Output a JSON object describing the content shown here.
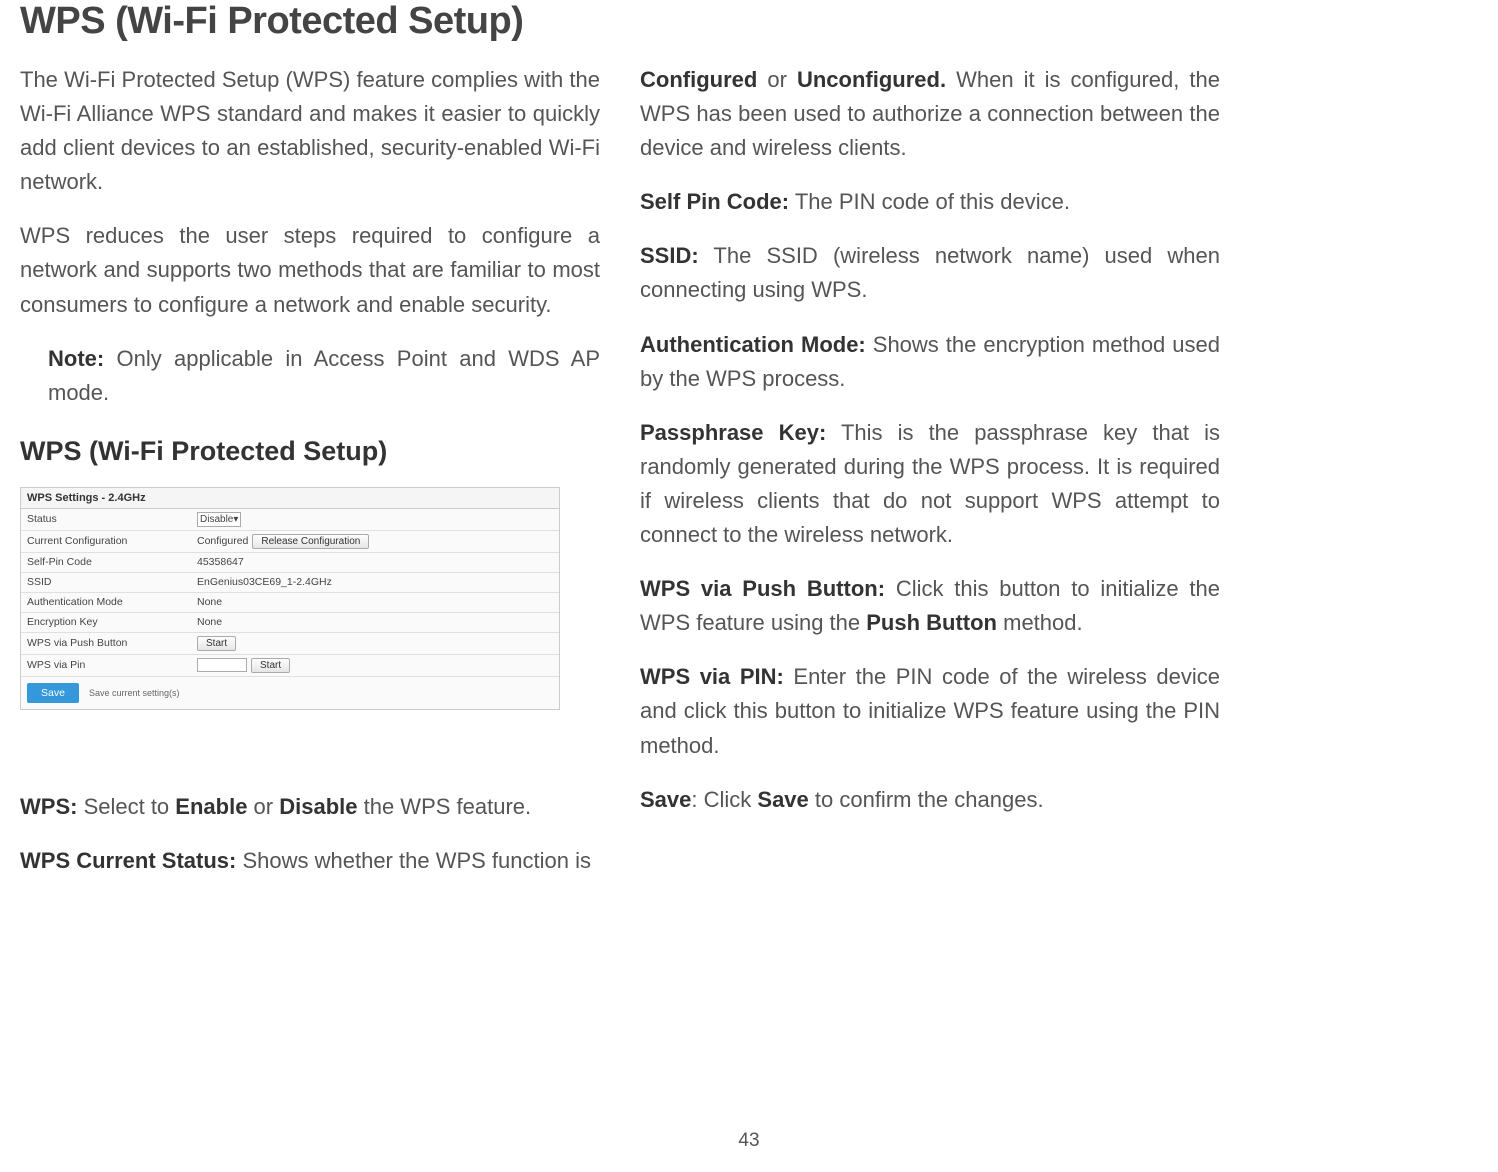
{
  "page_title": "WPS (Wi-Fi Protected Setup)",
  "left": {
    "para1": "The Wi-Fi Protected Setup (WPS) feature complies with the Wi-Fi Alliance WPS standard and makes it easier to quickly add client devices to an established, security-enabled Wi-Fi network.",
    "para2": "WPS reduces the user steps required to configure a network and supports two methods that are familiar to most consumers to configure a network and enable security.",
    "note_label": "Note:",
    "note_text": " Only applicable in Access Point and WDS AP mode.",
    "section_header": "WPS (Wi-Fi Protected Setup)",
    "panel": {
      "title": "WPS Settings - 2.4GHz",
      "rows": {
        "status_label": "Status",
        "status_value": "Disable",
        "cc_label": "Current Configuration",
        "cc_value": "Configured",
        "cc_button": "Release Configuration",
        "pin_label": "Self-Pin Code",
        "pin_value": "45358647",
        "ssid_label": "SSID",
        "ssid_value": "EnGenius03CE69_1-2.4GHz",
        "auth_label": "Authentication Mode",
        "auth_value": "None",
        "enc_label": "Encryption Key",
        "enc_value": "None",
        "push_label": "WPS via Push Button",
        "push_button": "Start",
        "pin_via_label": "WPS via Pin",
        "pin_via_button": "Start"
      },
      "save_label": "Save",
      "save_hint": "Save current setting(s)"
    },
    "wps_label": "WPS:",
    "wps_text": " Select to ",
    "wps_enable": "Enable",
    "wps_or": " or ",
    "wps_disable": "Disable",
    "wps_text2": " the WPS feature.",
    "status_label": "WPS Current Status:",
    "status_text": " Shows whether the WPS function is"
  },
  "right": {
    "p1_b1": "Configured",
    "p1_mid": " or ",
    "p1_b2": "Unconfigured.",
    "p1_rest": " When it is configured, the WPS has been used to authorize a connection between the device and wireless clients.",
    "p2_b": "Self Pin Code:",
    "p2_rest": " The PIN code of this device.",
    "p3_b": "SSID:",
    "p3_rest": " The SSID (wireless network name) used when connecting using WPS.",
    "p4_b": "Authentication Mode:",
    "p4_rest": " Shows the encryption method used by the WPS process.",
    "p5_b": "Passphrase Key:",
    "p5_rest": " This is the passphrase key that is randomly generated during the WPS process. It is required if wireless clients that do not support WPS attempt to connect to the wireless network.",
    "p6_b": "WPS via Push Button:",
    "p6_rest": " Click this button to initialize the WPS feature using the ",
    "p6_b2": "Push Button",
    "p6_rest2": " method.",
    "p7_b": "WPS via PIN:",
    "p7_rest": " Enter the PIN code of the wireless device and click this button to initialize WPS feature using the PIN method.",
    "p8_b": "Save",
    "p8_mid": ": Click ",
    "p8_b2": "Save",
    "p8_rest": " to confirm the changes."
  },
  "page_number": "43"
}
